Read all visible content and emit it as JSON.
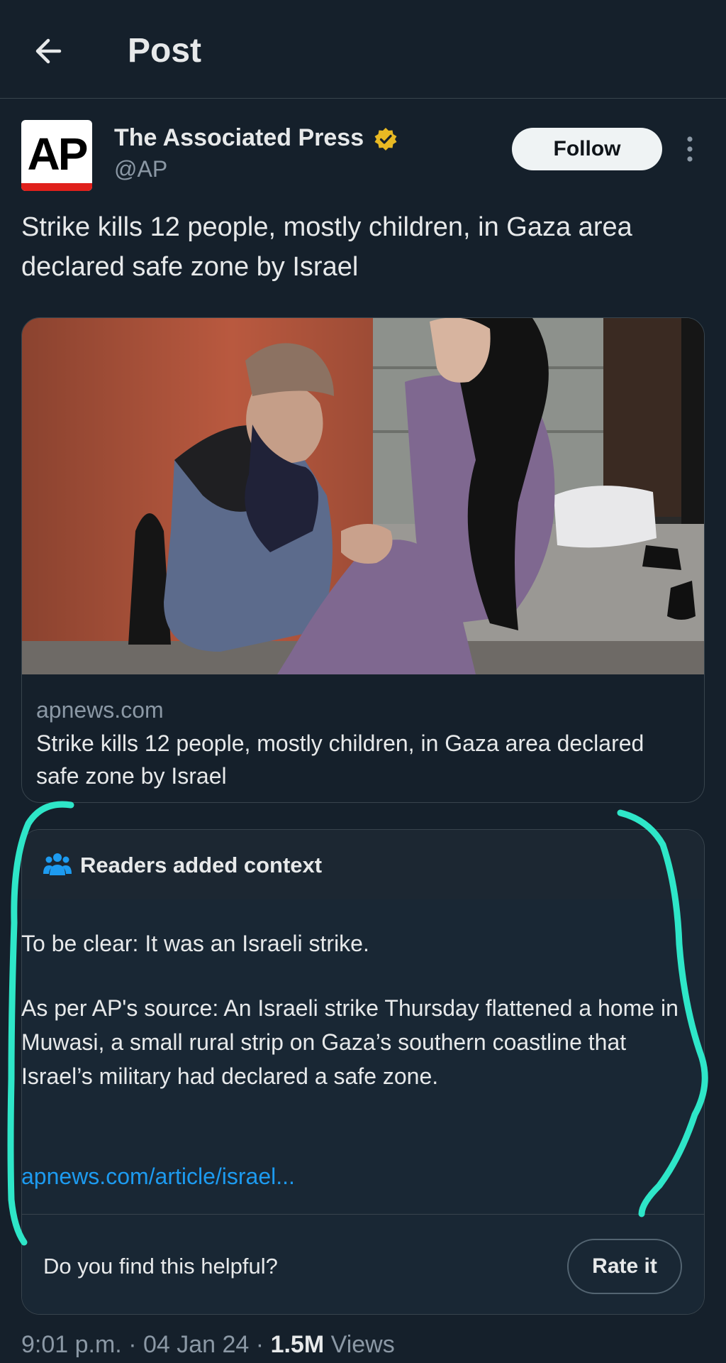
{
  "header": {
    "title": "Post",
    "back_icon": "arrow-left-icon"
  },
  "author": {
    "avatar_text": "AP",
    "display_name": "The Associated Press",
    "handle": "@AP",
    "verified_icon": "verified-gold-badge-icon",
    "follow_label": "Follow",
    "more_icon": "more-vertical-icon"
  },
  "post": {
    "text": "Strike kills 12 people, mostly children, in Gaza area declared safe zone by Israel"
  },
  "link_card": {
    "domain": "apnews.com",
    "title": "Strike kills 12 people, mostly children, in Gaza area declared safe zone by Israel"
  },
  "community_note": {
    "header_icon": "people-group-icon",
    "header": "Readers added context",
    "paragraph_1": "To be clear: It was an Israeli strike.",
    "paragraph_2": "As per AP's source: An Israeli strike Thursday flattened a home in Muwasi, a small rural strip on Gaza’s southern coastline that Israel’s military had declared a safe zone.",
    "link": "apnews.com/article/israel...",
    "helpful_question": "Do you find this helpful?",
    "rate_label": "Rate it"
  },
  "meta": {
    "time": "9:01 p.m.",
    "separator": "·",
    "date": "04 Jan 24",
    "views_count": "1.5M",
    "views_label": "Views"
  },
  "colors": {
    "background": "#15202b",
    "note_background": "#192734",
    "link": "#1d9bf0",
    "annotation_stroke": "#2ee6c8",
    "verified_badge": "#e8b923"
  }
}
